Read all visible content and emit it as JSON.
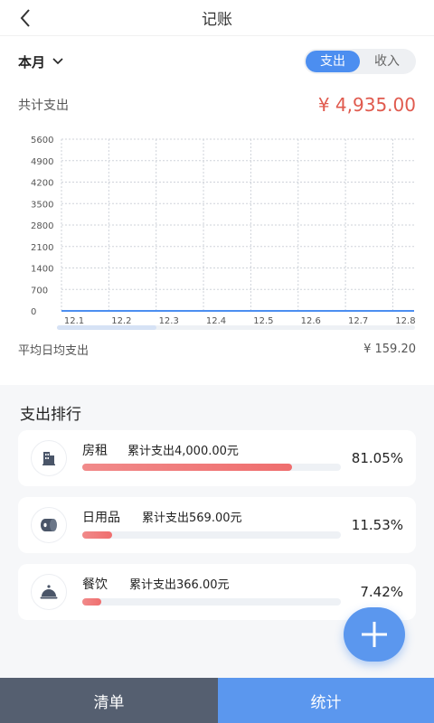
{
  "nav": {
    "title": "记账"
  },
  "summary": {
    "period": "本月",
    "toggle": {
      "expense": "支出",
      "income": "收入"
    },
    "total_label": "共计支出",
    "total_amount": "¥ 4,935.00",
    "avg_label": "平均日均支出",
    "avg_amount": "¥ 159.20"
  },
  "chart_data": {
    "type": "line",
    "x": [
      "12.1",
      "12.2",
      "12.3",
      "12.4",
      "12.5",
      "12.6",
      "12.7",
      "12.8"
    ],
    "yticks": [
      "0",
      "700",
      "1400",
      "2100",
      "2800",
      "3500",
      "4200",
      "4900",
      "5600"
    ],
    "ylim": [
      0,
      5600
    ],
    "series": [
      {
        "values": [
          0,
          0,
          0,
          0,
          0,
          0,
          0,
          0
        ]
      }
    ],
    "grid": true,
    "colors": {
      "line": "#4c8ef0",
      "grid": "#cfd3da",
      "axis": "#999999"
    }
  },
  "ranking": {
    "title": "支出排行",
    "items": [
      {
        "name": "房租",
        "total": "累计支出4,000.00元",
        "percent": "81.05%",
        "ratio": 0.8105,
        "icon": "building-icon"
      },
      {
        "name": "日用品",
        "total": "累计支出569.00元",
        "percent": "11.53%",
        "ratio": 0.1153,
        "icon": "toilet-paper-icon"
      },
      {
        "name": "餐饮",
        "total": "累计支出366.00元",
        "percent": "7.42%",
        "ratio": 0.0742,
        "icon": "cloche-icon"
      }
    ]
  },
  "fab": {
    "icon": "plus-icon"
  },
  "bottom": {
    "list_label": "清单",
    "stats_label": "统计"
  }
}
